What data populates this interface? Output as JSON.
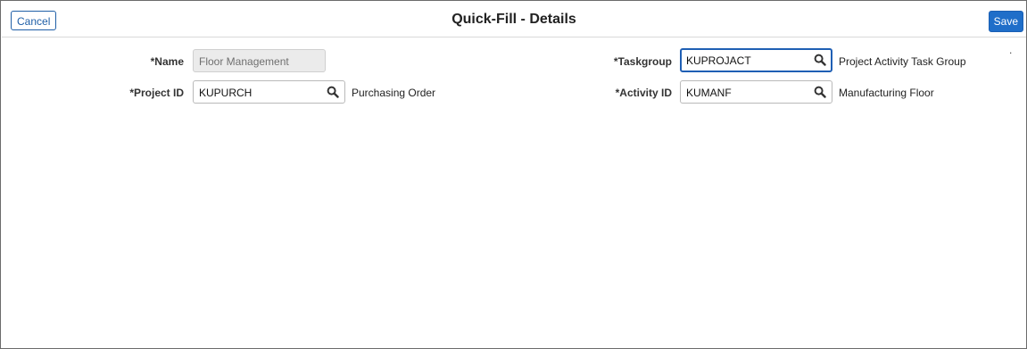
{
  "header": {
    "title": "Quick-Fill - Details",
    "cancel_label": "Cancel",
    "save_label": "Save"
  },
  "form": {
    "name": {
      "label": "*Name",
      "value": "Floor Management"
    },
    "project_id": {
      "label": "*Project ID",
      "value": "KUPURCH",
      "description": "Purchasing Order"
    },
    "taskgroup": {
      "label": "*Taskgroup",
      "value": "KUPROJACT",
      "description": "Project Activity Task Group"
    },
    "activity_id": {
      "label": "*Activity ID",
      "value": "KUMANF",
      "description": "Manufacturing Floor"
    }
  },
  "misc": {
    "dot": "."
  },
  "colors": {
    "accent": "#1f6ec9",
    "focus_border": "#1f5fb4",
    "disabled_bg": "#ebebeb"
  }
}
